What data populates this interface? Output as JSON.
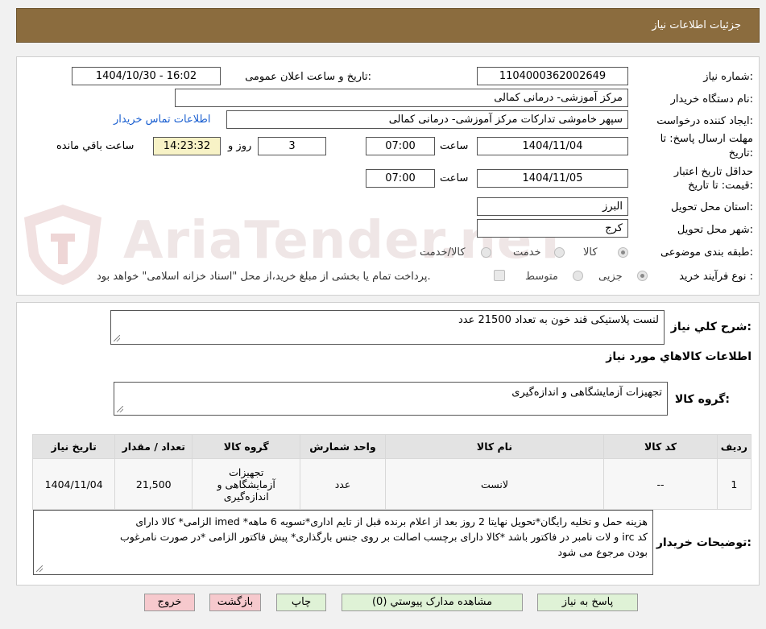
{
  "header": {
    "title": "جزئیات اطلاعات نیاز"
  },
  "fields": {
    "need_number_label": "شماره نیاز:",
    "need_number": "1104000362002649",
    "announce_label": "تاریخ و ساعت اعلان عمومی:",
    "announce_value": "1404/10/30 - 16:02",
    "buyer_org_label": "نام دستگاه خریدار:",
    "buyer_org": "مرکز آموزشی- درمانی کمالی",
    "creator_label": "ایجاد کننده درخواست:",
    "creator": "سپهر خاموشی تدارکات مرکز آموزشی- درمانی کمالی",
    "contact_link": "اطلاعات تماس خریدار",
    "deadline_label_1": "مهلت ارسال پاسخ: تا",
    "deadline_label_2": "تاریخ:",
    "deadline_date": "1404/11/04",
    "time_label": "ساعت",
    "deadline_time": "07:00",
    "days_value": "3",
    "days_label": "روز و",
    "remaining_time": "14:23:32",
    "remaining_label": "ساعت باقي مانده",
    "validity_label_1": "حداقل تاریخ اعتبار",
    "validity_label_2": "قیمت: تا تاریخ:",
    "validity_date": "1404/11/05",
    "validity_time_label": "ساعت",
    "validity_time": "07:00",
    "province_label": "استان محل تحویل:",
    "province": "البرز",
    "city_label": "شهر محل تحویل:",
    "city": "کرج",
    "category_label": "طبقه بندی موضوعی:",
    "category_options": [
      "کالا",
      "خدمت",
      "کالا/خدمت"
    ],
    "category_selected": "کالا",
    "process_label": "نوع فرآیند خرید :",
    "process_options": [
      "جزیی",
      "متوسط"
    ],
    "process_selected": "جزیی",
    "payment_note": "پرداخت تمام یا بخشی از مبلغ خرید،از محل \"اسناد خزانه اسلامی\" خواهد بود."
  },
  "summary": {
    "label": "شرح کلي نياز:",
    "value": "لنست پلاستیکی قند خون به تعداد 21500 عدد",
    "goods_info_title": "اطلاعات کالاهاي مورد نياز",
    "group_label": "گروه کالا:",
    "group_value": "تجهیزات آزمایشگاهی و اندازه‌گیری"
  },
  "table": {
    "headers": [
      "رديف",
      "کد کالا",
      "نام کالا",
      "واحد شمارش",
      "گروه کالا",
      "تعداد / مقدار",
      "تاریخ نیاز"
    ],
    "row": {
      "index": "1",
      "code": "--",
      "name": "لانست",
      "unit": "عدد",
      "group_line1": "تجهیزات",
      "group_line2": "آزمایشگاهی و",
      "group_line3": "اندازه‌گیری",
      "qty": "21,500",
      "date": "1404/11/04"
    }
  },
  "notes": {
    "label": "توضیحات خریدار:",
    "line1": "هزینه حمل و تخلیه رایگان*تحویل نهایتا 2 روز بعد از اعلام برنده قبل از تایم اداری*تسویه 6 ماهه* imed الزامی* کالا دارای",
    "line2": "کد irc و لات نامبر در فاکتور باشد *کالا دارای برچسب اصالت بر روی جنس بارگذاری* پیش فاکتور الزامی *در صورت نامرغوب",
    "line3": "بودن مرجوع می شود"
  },
  "buttons": {
    "reply": "پاسخ به نیاز",
    "attachments": "مشاهده مدارک پیوستي (0)",
    "print": "چاپ",
    "back": "بازگشت",
    "exit": "خروج"
  },
  "watermark": {
    "text": "AriaTender.neT"
  },
  "colors": {
    "header_bg": "#8b6c3e",
    "link": "#1a5fd0",
    "button_green": "#dff2d6",
    "button_pink": "#f6c9cd"
  }
}
